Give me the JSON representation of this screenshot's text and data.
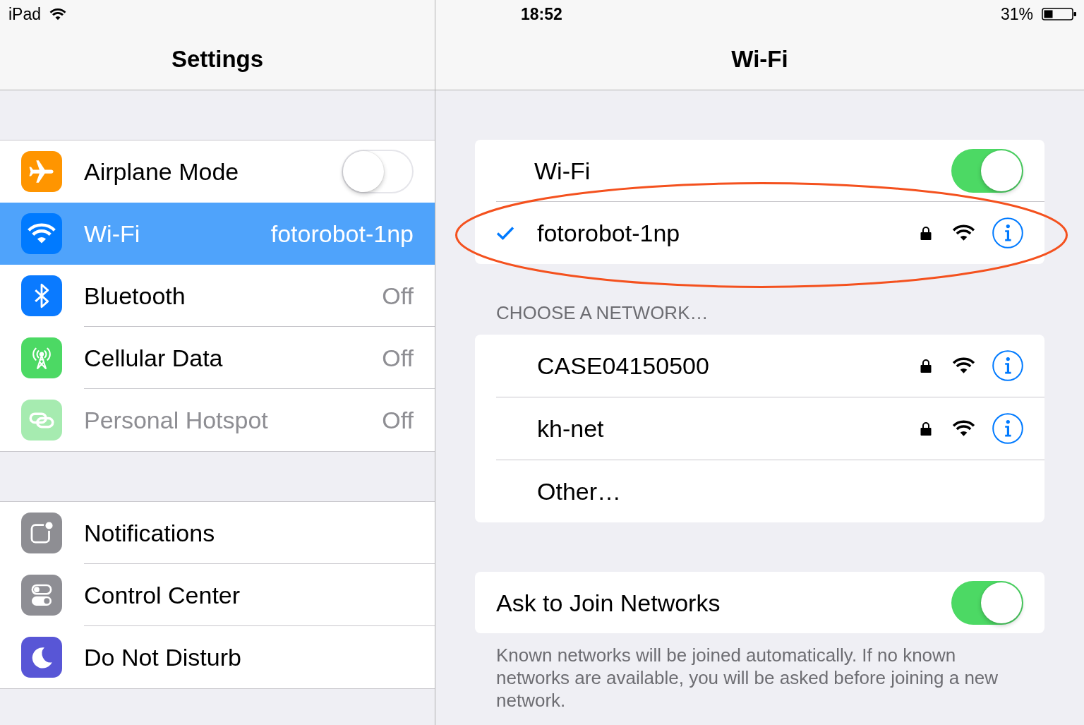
{
  "status_bar": {
    "device": "iPad",
    "time": "18:52",
    "battery": "31%"
  },
  "master": {
    "title": "Settings",
    "groups": [
      {
        "items": [
          {
            "label": "Airplane Mode",
            "kind": "toggle",
            "on": false,
            "selected": false,
            "disabled": false,
            "color": "#ff9500"
          },
          {
            "label": "Wi-Fi",
            "kind": "value",
            "value": "fotorobot-1np",
            "selected": true,
            "disabled": false,
            "color": "#007aff"
          },
          {
            "label": "Bluetooth",
            "kind": "value",
            "value": "Off",
            "selected": false,
            "disabled": false,
            "color": "#0a7aff"
          },
          {
            "label": "Cellular Data",
            "kind": "value",
            "value": "Off",
            "selected": false,
            "disabled": false,
            "color": "#4cd964"
          },
          {
            "label": "Personal Hotspot",
            "kind": "value",
            "value": "Off",
            "selected": false,
            "disabled": true,
            "color": "#a6ebb0"
          }
        ]
      },
      {
        "items": [
          {
            "label": "Notifications",
            "kind": "link",
            "selected": false,
            "disabled": false,
            "color": "#8e8e93"
          },
          {
            "label": "Control Center",
            "kind": "link",
            "selected": false,
            "disabled": false,
            "color": "#8e8e94"
          },
          {
            "label": "Do Not Disturb",
            "kind": "link",
            "selected": false,
            "disabled": false,
            "color": "#5856d6"
          }
        ]
      }
    ]
  },
  "detail": {
    "title": "Wi-Fi",
    "wifi": {
      "label": "Wi-Fi",
      "on": true
    },
    "current_network": {
      "name": "fotorobot-1np",
      "checked": true,
      "secured": true,
      "highlighted": true
    },
    "section_header": "CHOOSE A NETWORK…",
    "networks": [
      {
        "kind": "network",
        "name": "CASE04150500",
        "secured": true
      },
      {
        "kind": "network",
        "name": "kh-net",
        "secured": true
      },
      {
        "kind": "other",
        "name": "Other…"
      }
    ],
    "ask_to_join": {
      "label": "Ask to Join Networks",
      "on": true
    },
    "footer": "Known networks will be joined automatically. If no known networks are available, you will be asked before joining a new network."
  }
}
